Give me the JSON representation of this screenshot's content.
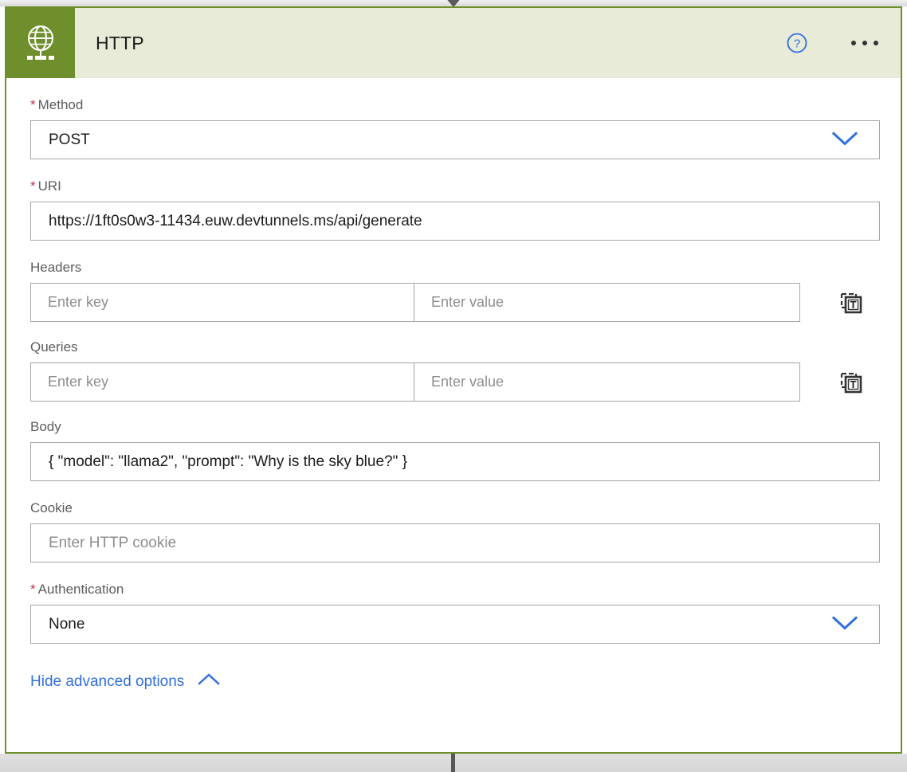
{
  "card": {
    "header": {
      "icon": "globe-network-icon",
      "title": "HTTP",
      "help_icon": "help-circle-icon",
      "more_icon": "more-ellipsis-icon",
      "accent_color": "#6f8f2c",
      "band_color": "#e7ebd8"
    },
    "fields": [
      {
        "id": "method",
        "label": "Method",
        "required": true,
        "type": "select",
        "value": "POST",
        "chevron": "chevron-down-icon"
      },
      {
        "id": "uri",
        "label": "URI",
        "required": true,
        "type": "text",
        "value": "https://1ft0s0w3-11434.euw.devtunnels.ms/api/generate"
      },
      {
        "id": "headers",
        "label": "Headers",
        "required": false,
        "type": "keyvalue",
        "key_placeholder": "Enter key",
        "value_placeholder": "Enter value",
        "toggle_icon": "switch-to-text-mode-icon"
      },
      {
        "id": "queries",
        "label": "Queries",
        "required": false,
        "type": "keyvalue",
        "key_placeholder": "Enter key",
        "value_placeholder": "Enter value",
        "toggle_icon": "switch-to-text-mode-icon"
      },
      {
        "id": "body",
        "label": "Body",
        "required": false,
        "type": "text",
        "value": "{ \"model\": \"llama2\", \"prompt\": \"Why is the sky blue?\" }"
      },
      {
        "id": "cookie",
        "label": "Cookie",
        "required": false,
        "type": "text",
        "value": "",
        "placeholder": "Enter HTTP cookie"
      },
      {
        "id": "authentication",
        "label": "Authentication",
        "required": true,
        "type": "select",
        "value": "None",
        "chevron": "chevron-down-icon"
      }
    ],
    "advanced_toggle": {
      "label": "Hide advanced options",
      "icon": "chevron-up-icon",
      "color": "#2f6fe0"
    }
  }
}
